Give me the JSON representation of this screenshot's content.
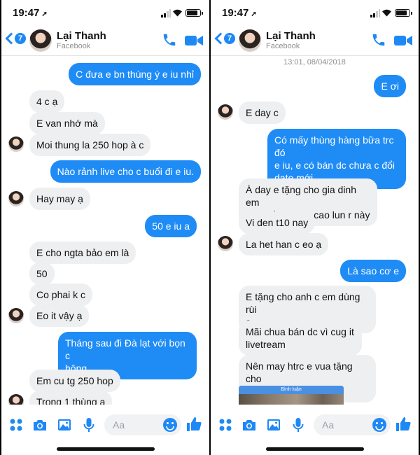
{
  "colors": {
    "accent": "#1f8cf6",
    "incoming": "#eeeff1"
  },
  "left": {
    "status": {
      "time": "19:47"
    },
    "header": {
      "back_count": "7",
      "name": "Lại Thanh",
      "subtitle": "Facebook"
    },
    "messages": [
      {
        "from": "me",
        "text": "C đưa e bn thùng ý e iu nhỉ"
      },
      {
        "from": "them",
        "text": "4 c ạ"
      },
      {
        "from": "them",
        "text": "E van nhớ mà"
      },
      {
        "from": "them",
        "text": "Moi thung la 250 hop à c"
      },
      {
        "from": "me",
        "text": "Nào rảnh live cho c buổi đi e iu."
      },
      {
        "from": "them",
        "text": "Hay may ạ"
      },
      {
        "from": "me",
        "text": "50 e iu a"
      },
      {
        "from": "them",
        "text": "E cho ngta bảo em là"
      },
      {
        "from": "them",
        "text": "50"
      },
      {
        "from": "them",
        "text": "Co phai k c"
      },
      {
        "from": "them",
        "text": "Eo it vậy ạ"
      },
      {
        "from": "me",
        "text": "Tháng sau đi Đà lạt với bọn c\nhông"
      },
      {
        "from": "them",
        "text": "Em cu tg 250 hop"
      },
      {
        "from": "them",
        "text": "Trong 1 thùng ạ"
      }
    ],
    "input": {
      "placeholder": "Aa"
    }
  },
  "right": {
    "status": {
      "time": "19:47"
    },
    "header": {
      "back_count": "7",
      "name": "Lại Thanh",
      "subtitle": "Facebook"
    },
    "timestamp": "13:01, 08/04/2018",
    "messages": [
      {
        "from": "me",
        "text": "E ơi"
      },
      {
        "from": "them",
        "text": "E day c"
      },
      {
        "from": "me",
        "text": "Có mấy thùng hàng bữa trc đó\ne iu, e có bán dc chưa c đổi\ndate mới"
      },
      {
        "from": "them",
        "text": "À day e tặng cho gia dinh em\ndùng rồi quang cao lun r này"
      },
      {
        "from": "them",
        "text": "Vi den t10 nay"
      },
      {
        "from": "them",
        "text": "La het han c eo ạ"
      },
      {
        "from": "me",
        "text": "Là sao cơ e"
      },
      {
        "from": "them",
        "text": "E tặng cho anh c em dùng rùi\nạ"
      },
      {
        "from": "them",
        "text": "Mãi chua bán dc vì cug it\nlivetream"
      },
      {
        "from": "them",
        "text": "Nên may htrc e vua tặng cho\nac e dùng"
      }
    ],
    "preview_label": "Bình luận",
    "input": {
      "placeholder": "Aa"
    }
  }
}
